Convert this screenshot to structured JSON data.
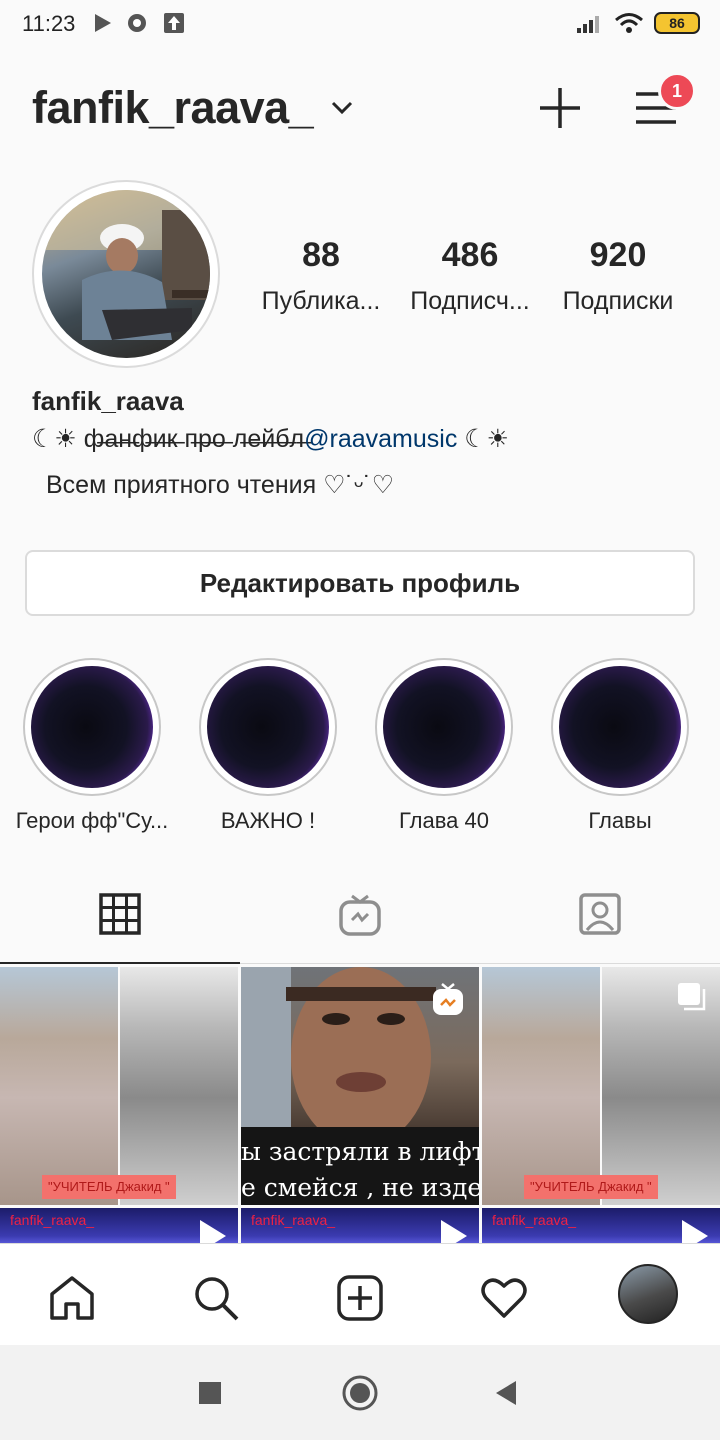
{
  "status_bar": {
    "time": "11:23",
    "battery": "86"
  },
  "header": {
    "username": "fanfik_raava_",
    "notification_count": "1"
  },
  "stats": [
    {
      "value": "88",
      "label": "Публика..."
    },
    {
      "value": "486",
      "label": "Подписч..."
    },
    {
      "value": "920",
      "label": "Подписки"
    }
  ],
  "bio": {
    "name": "fanfik_raava",
    "line1_prefix": "☾☀ ф̶а̶н̶ф̶и̶к̶ п̶р̶о̶ л̶е̶й̶б̶л̶",
    "mention": "@raavamusic",
    "line1_suffix": " ☾☀",
    "line2": "Всем приятного чтения ♡˙ᵕ˙♡"
  },
  "edit_profile_label": "Редактировать профиль",
  "highlights": [
    {
      "label": "Герои фф\"Су..."
    },
    {
      "label": "ВАЖНО !"
    },
    {
      "label": "Глава 40"
    },
    {
      "label": "Главы"
    }
  ],
  "tabs": [
    "grid-icon",
    "igtv-icon",
    "tagged-icon"
  ],
  "posts": {
    "post1_caption": "\"УЧИТЕЛЬ Джакид \"",
    "post2_subtitle1": "ы застряли в лифт",
    "post2_subtitle2": "е смейся , не издев",
    "post3_caption": "\"УЧИТЕЛЬ Джакид \"",
    "row2_tag": "fanfik_raava_"
  },
  "colors": {
    "notification": "#ed4956",
    "mention": "#00376b",
    "battery": "#f4c430"
  }
}
